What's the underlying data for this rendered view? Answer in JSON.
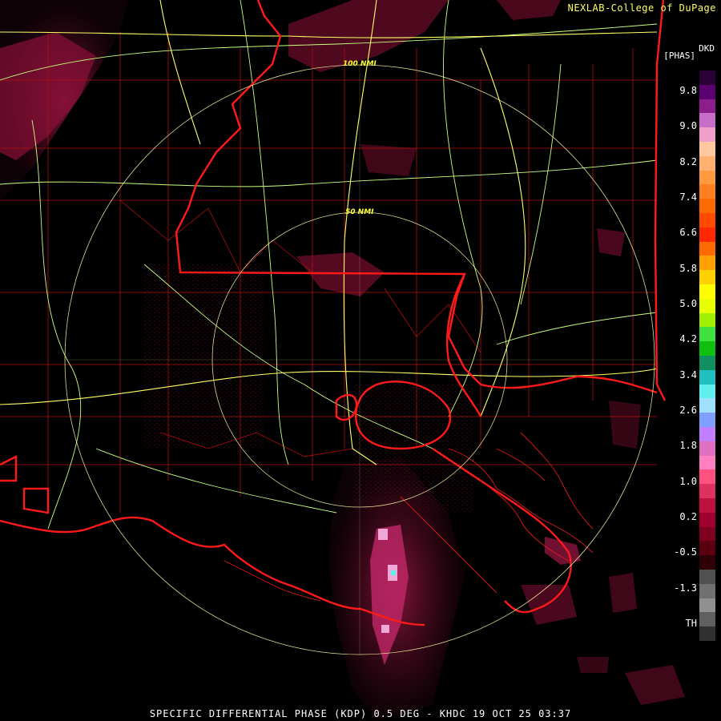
{
  "credit": "NEXLAB-College of DuPage",
  "product": {
    "site_code": "DKD",
    "unit_label": "[PHAS]",
    "caption": "SPECIFIC DIFFERENTIAL PHASE (KDP) 0.5 DEG - KHDC 19 OCT 25 03:37"
  },
  "range_rings": [
    {
      "label": "100 NMI"
    },
    {
      "label": "50 NMI"
    }
  ],
  "legend": {
    "ticks": [
      "9.8",
      "9.0",
      "8.2",
      "7.4",
      "6.6",
      "5.8",
      "5.0",
      "4.2",
      "3.4",
      "2.6",
      "1.8",
      "1.0",
      "0.2",
      "-0.5",
      "-1.3",
      "TH"
    ],
    "colors": [
      "#2a0036",
      "#5a0070",
      "#8c1e8c",
      "#c86ec8",
      "#f0a0c8",
      "#ffc8a0",
      "#ffb070",
      "#ff9a40",
      "#ff8020",
      "#ff6a00",
      "#ff4a00",
      "#ff2800",
      "#ff6a00",
      "#ffa000",
      "#ffd000",
      "#ffff00",
      "#e8ff00",
      "#a0f000",
      "#40e040",
      "#10c010",
      "#109060",
      "#20c0c0",
      "#60f0f0",
      "#a0e0ff",
      "#80a0ff",
      "#c080ff",
      "#e070c0",
      "#ff80c0",
      "#ff5080",
      "#e03060",
      "#c01040",
      "#a00030",
      "#800020",
      "#5a0010",
      "#300008",
      "#505050",
      "#707070",
      "#909090",
      "#606060",
      "#303030"
    ]
  },
  "colors": {
    "state_border": "#ff1a1a",
    "county_line": "#b01010",
    "highway": "#c8ff80",
    "interstate": "#ffff66",
    "range_ring": "#ffffaa",
    "echo_base": "#7a0f2e"
  }
}
